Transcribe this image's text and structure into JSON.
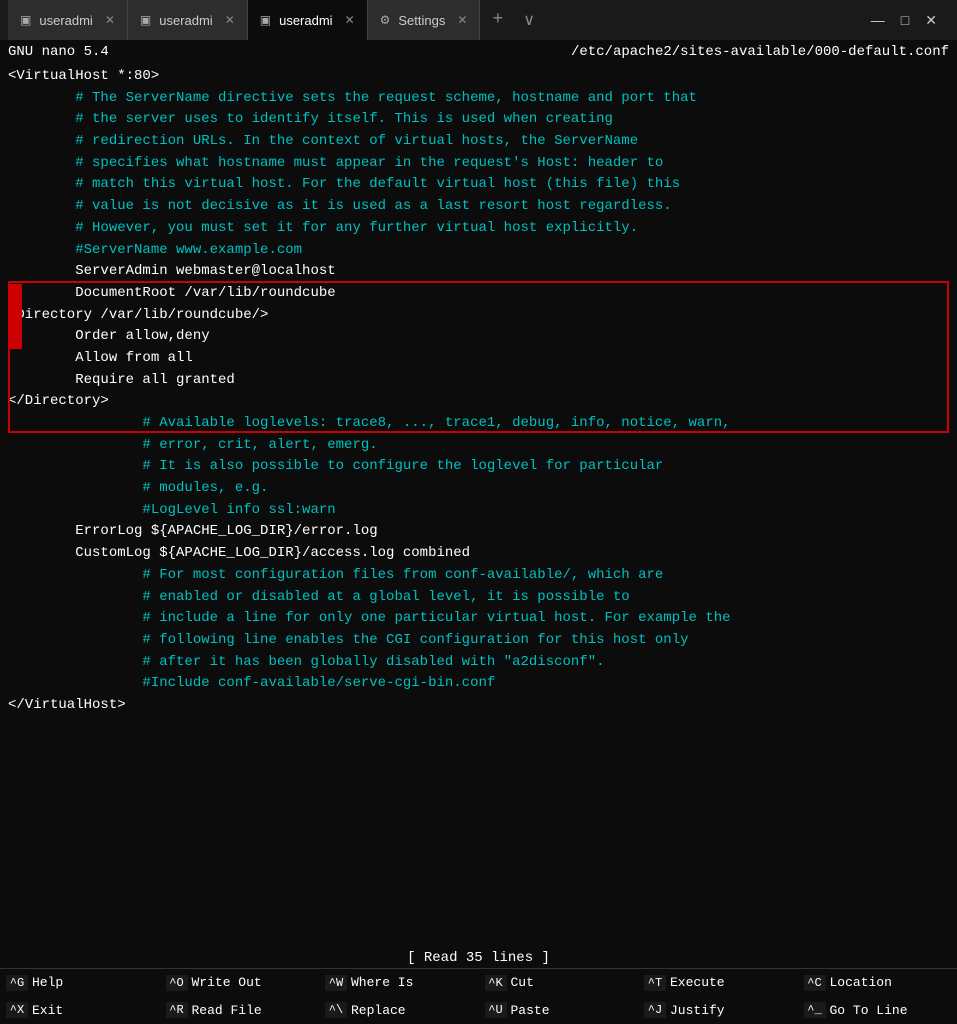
{
  "titlebar": {
    "tabs": [
      {
        "id": "tab1",
        "icon": "terminal",
        "label": "useradmi",
        "active": false
      },
      {
        "id": "tab2",
        "icon": "terminal",
        "label": "useradmi",
        "active": false
      },
      {
        "id": "tab3",
        "icon": "terminal",
        "label": "useradmi",
        "active": true
      },
      {
        "id": "tab4",
        "icon": "gear",
        "label": "Settings",
        "active": false
      }
    ],
    "window_controls": [
      "—",
      "□",
      "✕"
    ]
  },
  "nano": {
    "version": "GNU nano 5.4",
    "filepath": "/etc/apache2/sites-available/000-default.conf"
  },
  "editor_lines": [
    {
      "type": "normal",
      "text": "<VirtualHost *:80>"
    },
    {
      "type": "comment",
      "text": "\t# The ServerName directive sets the request scheme, hostname and port that"
    },
    {
      "type": "comment",
      "text": "\t# the server uses to identify itself. This is used when creating"
    },
    {
      "type": "comment",
      "text": "\t# redirection URLs. In the context of virtual hosts, the ServerName"
    },
    {
      "type": "comment",
      "text": "\t# specifies what hostname must appear in the request's Host: header to"
    },
    {
      "type": "comment",
      "text": "\t# match this virtual host. For the default virtual host (this file) this"
    },
    {
      "type": "comment",
      "text": "\t# value is not decisive as it is used as a last resort host regardless."
    },
    {
      "type": "comment",
      "text": "\t# However, you must set it for any further virtual host explicitly."
    },
    {
      "type": "comment",
      "text": "\t#ServerName www.example.com"
    },
    {
      "type": "normal",
      "text": ""
    },
    {
      "type": "normal",
      "text": "\tServerAdmin webmaster@localhost"
    },
    {
      "type": "normal",
      "text": "\tDocumentRoot /var/lib/roundcube"
    },
    {
      "type": "normal",
      "text": "<Directory /var/lib/roundcube/>"
    },
    {
      "type": "normal",
      "text": "\tOrder allow,deny"
    },
    {
      "type": "normal",
      "text": "\tAllow from all"
    },
    {
      "type": "normal",
      "text": "\tRequire all granted"
    },
    {
      "type": "normal",
      "text": "</Directory>"
    },
    {
      "type": "normal",
      "text": ""
    },
    {
      "type": "comment",
      "text": "\t\t# Available loglevels: trace8, ..., trace1, debug, info, notice, warn,"
    },
    {
      "type": "comment",
      "text": "\t\t# error, crit, alert, emerg."
    },
    {
      "type": "comment",
      "text": "\t\t# It is also possible to configure the loglevel for particular"
    },
    {
      "type": "comment",
      "text": "\t\t# modules, e.g."
    },
    {
      "type": "comment",
      "text": "\t\t#LogLevel info ssl:warn"
    },
    {
      "type": "normal",
      "text": ""
    },
    {
      "type": "normal",
      "text": "\tErrorLog ${APACHE_LOG_DIR}/error.log"
    },
    {
      "type": "normal",
      "text": "\tCustomLog ${APACHE_LOG_DIR}/access.log combined"
    },
    {
      "type": "normal",
      "text": ""
    },
    {
      "type": "comment",
      "text": "\t\t# For most configuration files from conf-available/, which are"
    },
    {
      "type": "comment",
      "text": "\t\t# enabled or disabled at a global level, it is possible to"
    },
    {
      "type": "comment",
      "text": "\t\t# include a line for only one particular virtual host. For example the"
    },
    {
      "type": "comment",
      "text": "\t\t# following line enables the CGI configuration for this host only"
    },
    {
      "type": "comment",
      "text": "\t\t# after it has been globally disabled with \"a2disconf\"."
    },
    {
      "type": "comment",
      "text": "\t\t#Include conf-available/serve-cgi-bin.conf"
    },
    {
      "type": "normal",
      "text": "</VirtualHost>"
    }
  ],
  "status": "[ Read 35 lines ]",
  "shortcuts": [
    {
      "key": "^G",
      "label": "Help"
    },
    {
      "key": "^O",
      "label": "Write Out"
    },
    {
      "key": "^W",
      "label": "Where Is"
    },
    {
      "key": "^K",
      "label": "Cut"
    },
    {
      "key": "^T",
      "label": "Execute"
    },
    {
      "key": "^C",
      "label": "Location"
    },
    {
      "key": "^X",
      "label": "Exit"
    },
    {
      "key": "^R",
      "label": "Read File"
    },
    {
      "key": "^\\",
      "label": "Replace"
    },
    {
      "key": "^U",
      "label": "Paste"
    },
    {
      "key": "^J",
      "label": "Justify"
    },
    {
      "key": "^_",
      "label": "Go To Line"
    }
  ]
}
